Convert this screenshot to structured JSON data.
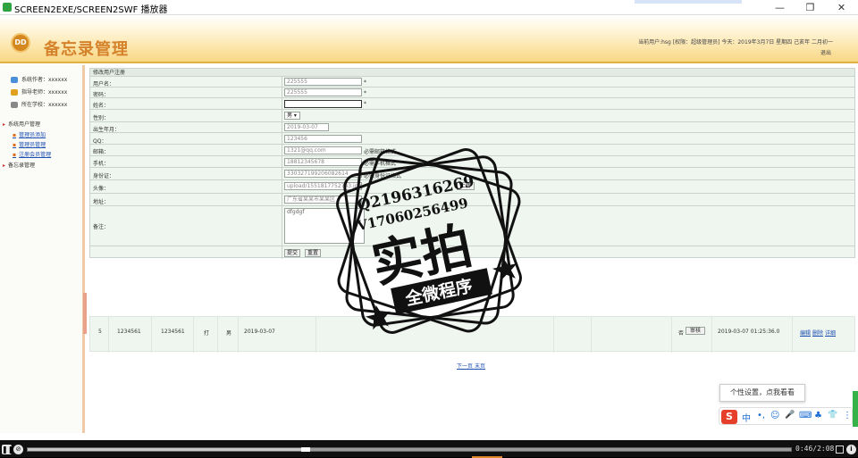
{
  "window": {
    "title": "SCREEN2EXE/SCREEN2SWF 播放器",
    "minimize_icon": "—",
    "restore_icon": "❐",
    "close_icon": "✕"
  },
  "header": {
    "logo_text": "DD",
    "app_name": "备忘录管理",
    "info": "当前用户:hsg [权限：超级管理员] 今天：2019年3月7日 星期四 己亥年 二月初一",
    "exit": "退出"
  },
  "sidebar": {
    "info": [
      {
        "label": "系统作者：xxxxxx",
        "color": "#4a8fd8"
      },
      {
        "label": "指导老师：xxxxxx",
        "color": "#e0a020"
      },
      {
        "label": "所在学校：xxxxxx",
        "color": "#888888"
      }
    ],
    "group_user": "系统用户管理",
    "links": [
      "管理员添加",
      "管理员管理",
      "注册会员管理"
    ],
    "group_memo": "备忘录管理"
  },
  "form": {
    "title": "修改用户注册",
    "labels": {
      "username": "用户名：",
      "password": "密码：",
      "name": "姓名：",
      "gender": "性别：",
      "birthday": "出生年月：",
      "qq": "QQ：",
      "email": "邮箱：",
      "phone": "手机：",
      "idcard": "身份证：",
      "avatar": "头像：",
      "address": "地址：",
      "remark": "备注："
    },
    "values": {
      "username": "225555",
      "password": "225555",
      "name": "",
      "gender": "男",
      "birthday": "2019-03-07",
      "qq": "123456",
      "email": "1321@qq.com",
      "phone": "18812345678",
      "idcard": "330327199206082614",
      "avatar": "upload/1551817752743.jpg",
      "address": "广东省某某市某某区",
      "remark": "dfgdgf"
    },
    "star": "*",
    "hints": {
      "email": "必需邮箱格式",
      "phone": "必需手机格式",
      "idcard": "必需身份证格式"
    },
    "upload_button": "上传",
    "submit_button": "提交",
    "reset_button": "重置"
  },
  "list_row": {
    "cells": [
      "5",
      "1234561",
      "1234561",
      "打",
      "男",
      "2019-03-07"
    ],
    "flag": "否",
    "review_button": "审核",
    "datetime": "2019-03-07 01:25:36.0",
    "actions": [
      "编辑",
      "删除",
      "详细"
    ]
  },
  "pager": {
    "next": "下一页",
    "last": "末页"
  },
  "stamp": {
    "line1": "Q2196316269",
    "line2": "V17060256499",
    "big": "实拍",
    "banner": "全微程序"
  },
  "ime": {
    "tooltip": "个性设置，点我看看",
    "logo": "S",
    "items": [
      "中",
      "•,",
      "☺",
      "🎤",
      "⌨",
      "♣",
      "👕",
      "⋮"
    ]
  },
  "player": {
    "pause_icon": "❚❚",
    "stop_icon": "⊘",
    "time": "0:46/2:08",
    "info_icon": "i",
    "progress": 0.364
  }
}
